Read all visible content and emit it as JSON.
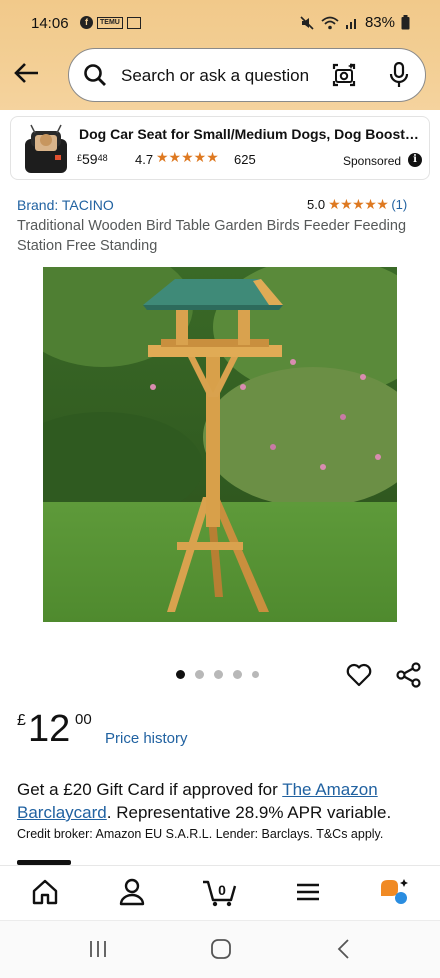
{
  "status_bar": {
    "time": "14:06",
    "left_icons": [
      "facebook-icon",
      "deal-icon",
      "card-icon"
    ],
    "deal_label": "TEMU",
    "battery": "83%"
  },
  "search": {
    "placeholder": "Search or ask a question"
  },
  "sponsored_ad": {
    "title": "Dog Car Seat for Small/Medium Dogs, Dog Booster Sea...",
    "currency": "£",
    "price_whole": "59",
    "price_fraction": "48",
    "rating": "4.7",
    "stars": "★★★★★",
    "rating_count": "625",
    "sponsored_label": "Sponsored"
  },
  "product": {
    "brand": "Brand: TACINO",
    "rating": "5.0",
    "stars": "★★★★★",
    "rating_count": "(1)",
    "title": "Traditional Wooden Bird Table Garden Birds Feeder Feeding Station Free Standing",
    "image_count": 5,
    "active_image": 1
  },
  "price": {
    "currency": "£",
    "whole": "12",
    "fraction": "00",
    "history_link": "Price history"
  },
  "gift_card": {
    "text_before": "Get a £20 Gift Card if approved for ",
    "link_1": "The Amazon",
    "link_2": "Barclaycard",
    "text_after": ". Representative 28.9% APR variable.",
    "credit_text": "Credit broker: Amazon EU S.A.R.L. Lender: Barclays. T&Cs apply."
  },
  "bottom_nav": {
    "items": [
      "home-icon",
      "account-icon",
      "cart-icon",
      "menu-icon",
      "rufus-icon"
    ],
    "cart_count": "0"
  },
  "colors": {
    "header_bg": "#f3cf95",
    "link": "#2162a1",
    "star": "#de7921",
    "text": "#0f1111"
  }
}
